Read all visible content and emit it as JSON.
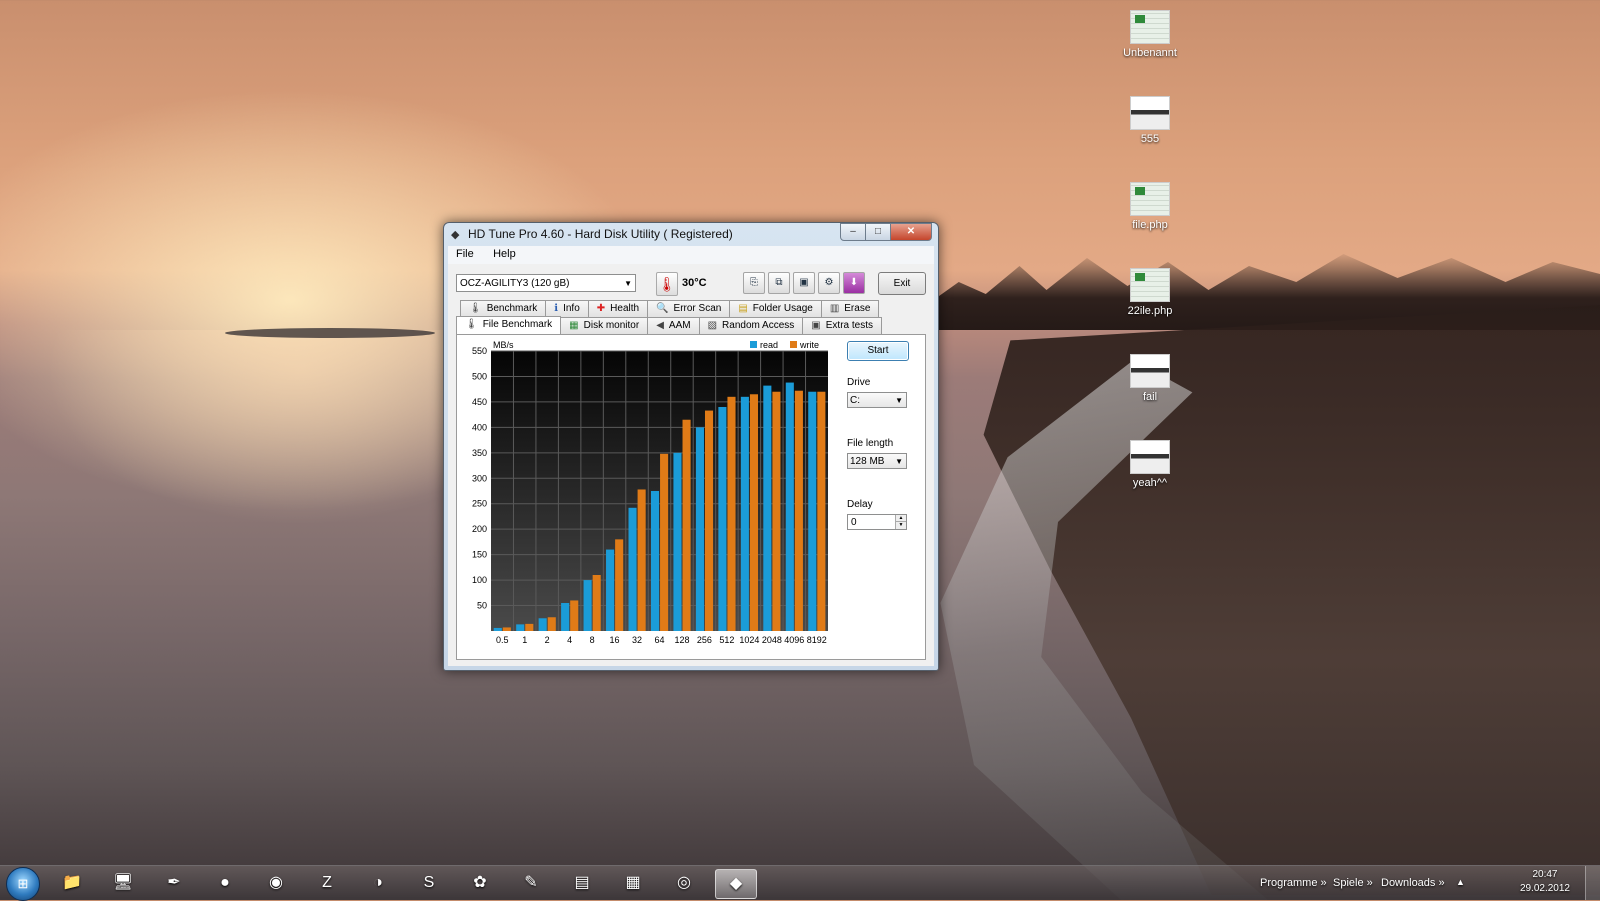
{
  "window": {
    "title": "HD Tune Pro 4.60 - Hard Disk Utility ( Registered)",
    "menu": [
      "File",
      "Help"
    ],
    "drive": "OCZ-AGILITY3 (120 gB)",
    "temperature": "30°C",
    "exit_label": "Exit",
    "toolbar_icons": [
      "copy-icon",
      "copy-all-icon",
      "save-icon",
      "options-icon",
      "download-icon"
    ]
  },
  "tabs": {
    "row1": [
      {
        "label": "Benchmark",
        "icon": "benchmark-icon"
      },
      {
        "label": "Info",
        "icon": "info-icon"
      },
      {
        "label": "Health",
        "icon": "health-icon"
      },
      {
        "label": "Error Scan",
        "icon": "error-scan-icon"
      },
      {
        "label": "Folder Usage",
        "icon": "folder-usage-icon"
      },
      {
        "label": "Erase",
        "icon": "erase-icon"
      }
    ],
    "row2": [
      {
        "label": "File Benchmark",
        "icon": "file-benchmark-icon",
        "active": true
      },
      {
        "label": "Disk monitor",
        "icon": "disk-monitor-icon"
      },
      {
        "label": "AAM",
        "icon": "aam-icon"
      },
      {
        "label": "Random Access",
        "icon": "random-access-icon"
      },
      {
        "label": "Extra tests",
        "icon": "extra-tests-icon"
      }
    ]
  },
  "controls": {
    "start_label": "Start",
    "drive_label": "Drive",
    "drive_value": "C:",
    "file_length_label": "File length",
    "file_length_value": "128 MB",
    "delay_label": "Delay",
    "delay_value": "0"
  },
  "chart_data": {
    "type": "bar",
    "ylabel": "MB/s",
    "ylim": [
      0,
      550
    ],
    "yticks": [
      50,
      100,
      150,
      200,
      250,
      300,
      350,
      400,
      450,
      500,
      550
    ],
    "categories": [
      "0.5",
      "1",
      "2",
      "4",
      "8",
      "16",
      "32",
      "64",
      "128",
      "256",
      "512",
      "1024",
      "2048",
      "4096",
      "8192"
    ],
    "series": [
      {
        "name": "read",
        "color": "#1b9cd8",
        "values": [
          6,
          13,
          25,
          55,
          100,
          160,
          242,
          275,
          350,
          400,
          440,
          460,
          482,
          488,
          470
        ]
      },
      {
        "name": "write",
        "color": "#e07b17",
        "values": [
          7,
          14,
          27,
          60,
          110,
          180,
          278,
          348,
          415,
          433,
          460,
          465,
          470,
          472,
          470
        ]
      }
    ],
    "legend": "top-right",
    "grid": true,
    "background": "dark"
  },
  "desktop_icons": [
    {
      "label": "Unbenannt",
      "type": "sheet"
    },
    {
      "label": "555",
      "type": "shot"
    },
    {
      "label": "file.php",
      "type": "sheet"
    },
    {
      "label": "22ile.php",
      "type": "sheet"
    },
    {
      "label": "fail",
      "type": "shot"
    },
    {
      "label": "yeah^^",
      "type": "shot"
    }
  ],
  "taskbar": {
    "pinned": [
      {
        "name": "explorer-icon",
        "glyph": "📁"
      },
      {
        "name": "control-panel-icon",
        "glyph": "🖥"
      },
      {
        "name": "inkscape-icon",
        "glyph": "✒"
      },
      {
        "name": "ccleaner-icon",
        "glyph": "●"
      },
      {
        "name": "firefox-icon",
        "glyph": "◉"
      },
      {
        "name": "filezilla-icon",
        "glyph": "Z"
      },
      {
        "name": "thunderbird-icon",
        "glyph": "◑"
      },
      {
        "name": "skype-icon",
        "glyph": "S"
      },
      {
        "name": "picasa-icon",
        "glyph": "✿"
      },
      {
        "name": "paint-icon",
        "glyph": "✎"
      },
      {
        "name": "winrar-icon",
        "glyph": "▤"
      },
      {
        "name": "video-editor-icon",
        "glyph": "▦"
      },
      {
        "name": "cd-burner-icon",
        "glyph": "◎"
      },
      {
        "name": "hdtune-icon",
        "glyph": "◆",
        "active": true
      }
    ],
    "toolbars": [
      "Programme",
      "Spiele",
      "Downloads"
    ],
    "time": "20:47",
    "date": "29.02.2012"
  }
}
